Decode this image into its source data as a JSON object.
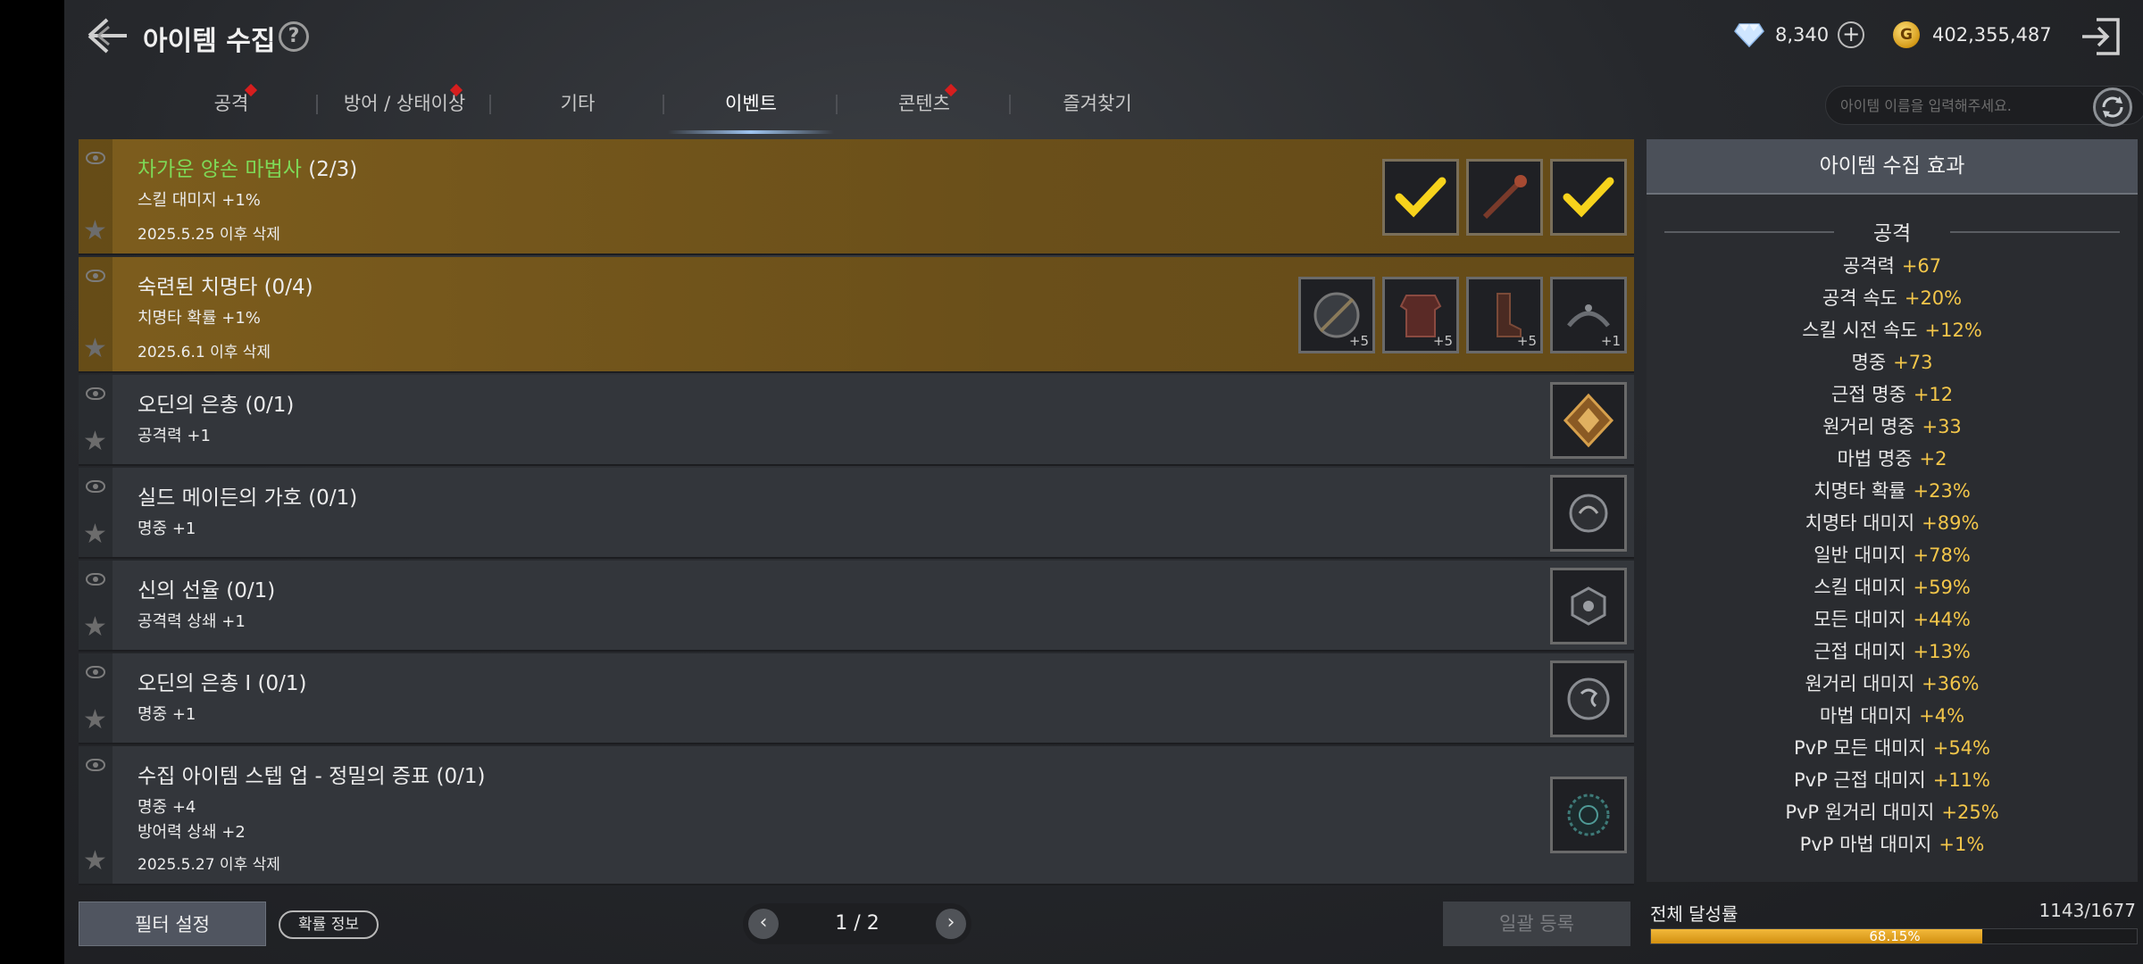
{
  "header": {
    "title": "아이템 수집",
    "help_icon": "?",
    "diamond_amount": "8,340",
    "gold_icon": "G",
    "gold_amount": "402,355,487"
  },
  "tabs": [
    {
      "label": "공격",
      "dot": true
    },
    {
      "label": "방어 / 상태이상",
      "dot": true
    },
    {
      "label": "기타",
      "dot": false
    },
    {
      "label": "이벤트",
      "dot": false,
      "active": true
    },
    {
      "label": "콘텐츠",
      "dot": true
    },
    {
      "label": "즐겨찾기",
      "dot": false
    }
  ],
  "search": {
    "placeholder": "아이템 이름을 입력해주세요."
  },
  "items": [
    {
      "name_highlight": "차가운 양손 마법사",
      "count": "(2/3)",
      "effect1": "스킬 대미지 +1%",
      "expiry": "2025.5.25 이후 삭제"
    },
    {
      "name": "숙련된 치명타 (0/4)",
      "effect1": "치명타 확률 +1%",
      "expiry": "2025.6.1 이후 삭제",
      "slot_levels": [
        "+5",
        "+5",
        "+5",
        "+1"
      ]
    },
    {
      "name": "오딘의 은총 (0/1)",
      "effect1": "공격력 +1"
    },
    {
      "name": "실드 메이든의 가호 (0/1)",
      "effect1": "명중 +1"
    },
    {
      "name": "신의 선율 (0/1)",
      "effect1": "공격력 상쇄 +1"
    },
    {
      "name": "오딘의 은총 I  (0/1)",
      "effect1": "명중 +1"
    },
    {
      "name": "수집 아이템 스텝 업 - 정밀의 증표 (0/1)",
      "effect1": "명중 +4",
      "effect2": "방어력 상쇄 +2",
      "expiry": "2025.5.27 이후 삭제"
    }
  ],
  "panel": {
    "title": "아이템 수집 효과",
    "section": "공격",
    "stats": [
      {
        "label": "공격력",
        "value": "+67"
      },
      {
        "label": "공격 속도",
        "value": "+20%"
      },
      {
        "label": "스킬 시전 속도",
        "value": "+12%"
      },
      {
        "label": "명중",
        "value": "+73"
      },
      {
        "label": "근접 명중",
        "value": "+12"
      },
      {
        "label": "원거리 명중",
        "value": "+33"
      },
      {
        "label": "마법 명중",
        "value": "+2"
      },
      {
        "label": "치명타 확률",
        "value": "+23%"
      },
      {
        "label": "치명타 대미지",
        "value": "+89%"
      },
      {
        "label": "일반 대미지",
        "value": "+78%"
      },
      {
        "label": "스킬 대미지",
        "value": "+59%"
      },
      {
        "label": "모든 대미지",
        "value": "+44%"
      },
      {
        "label": "근접 대미지",
        "value": "+13%"
      },
      {
        "label": "원거리 대미지",
        "value": "+36%"
      },
      {
        "label": "마법 대미지",
        "value": "+4%"
      },
      {
        "label": "PvP 모든 대미지",
        "value": "+54%"
      },
      {
        "label": "PvP 근접 대미지",
        "value": "+11%"
      },
      {
        "label": "PvP 원거리 대미지",
        "value": "+25%"
      },
      {
        "label": "PvP 마법 대미지",
        "value": "+1%"
      }
    ]
  },
  "bottom": {
    "filter_label": "필터 설정",
    "prob_label": "확률 정보",
    "page_text": "1 / 2",
    "bulk_label": "일괄 등록",
    "achievement_label": "전체 달성률",
    "achievement_count": "1143/1677",
    "achievement_pct": "68.15%",
    "achievement_fraction": 0.6815
  },
  "colors": {
    "accent_gold": "#f3c64a",
    "highlight_green": "#7ed957",
    "tab_dot_red": "#d61e1e"
  }
}
